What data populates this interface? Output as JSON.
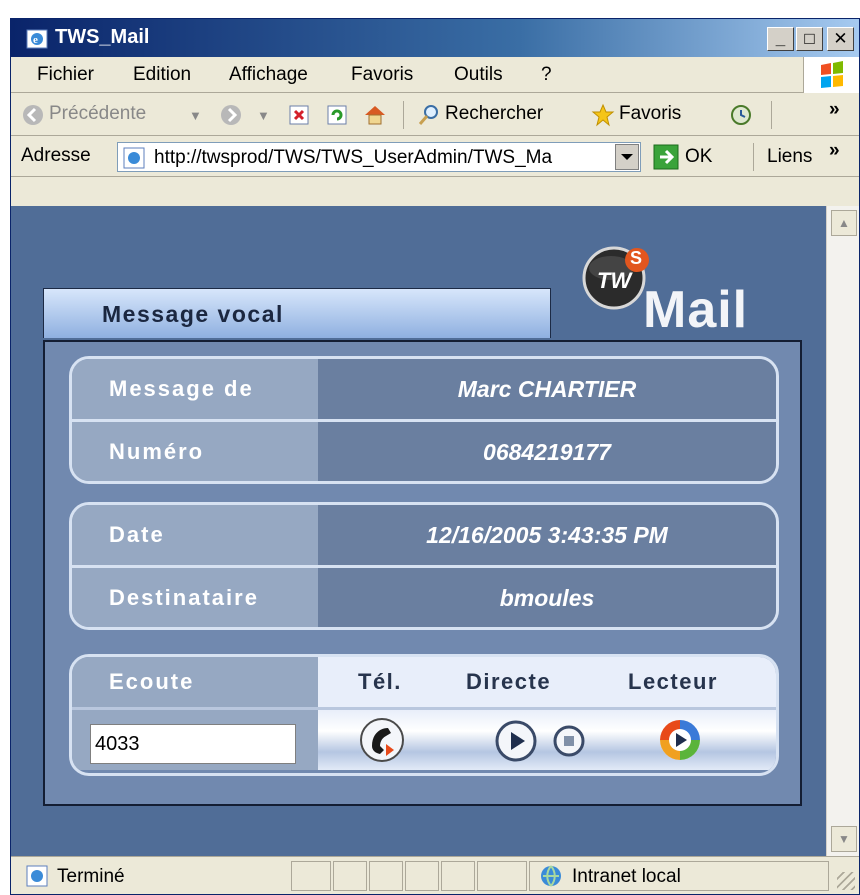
{
  "window": {
    "title": "TWS_Mail",
    "buttons": {
      "minimize": "_",
      "maximize": "□",
      "close": "✕"
    }
  },
  "menu": [
    "Fichier",
    "Edition",
    "Affichage",
    "Favoris",
    "Outils",
    "?"
  ],
  "toolbar": {
    "back": "Précédente",
    "search": "Rechercher",
    "favorites": "Favoris",
    "chevron": "»"
  },
  "address": {
    "label": "Adresse",
    "url": "http://twsprod/TWS/TWS_UserAdmin/TWS_Ma",
    "go": "OK",
    "links": "Liens",
    "chevron": "»"
  },
  "page": {
    "logo_suffix": "Mail",
    "logo_badge": "TW",
    "logo_s": "S",
    "tab_title": "Message vocal",
    "message": {
      "from_label": "Message de",
      "from_value": "Marc CHARTIER",
      "number_label": "Numéro",
      "number_value": "0684219177"
    },
    "details": {
      "date_label": "Date",
      "date_value": "12/16/2005 3:43:35 PM",
      "recipient_label": "Destinataire",
      "recipient_value": "bmoules"
    },
    "listen": {
      "label": "Ecoute",
      "col_phone": "Tél.",
      "col_direct": "Directe",
      "col_player": "Lecteur",
      "extension_value": "4033"
    }
  },
  "status": {
    "text": "Terminé",
    "zone": "Intranet local"
  },
  "colors": {
    "page_bg": "#506d97",
    "panel_bg": "#7189af",
    "label_bg": "#96a8c2",
    "value_bg": "#6a7fa0",
    "title_bar": "#0a246a"
  }
}
